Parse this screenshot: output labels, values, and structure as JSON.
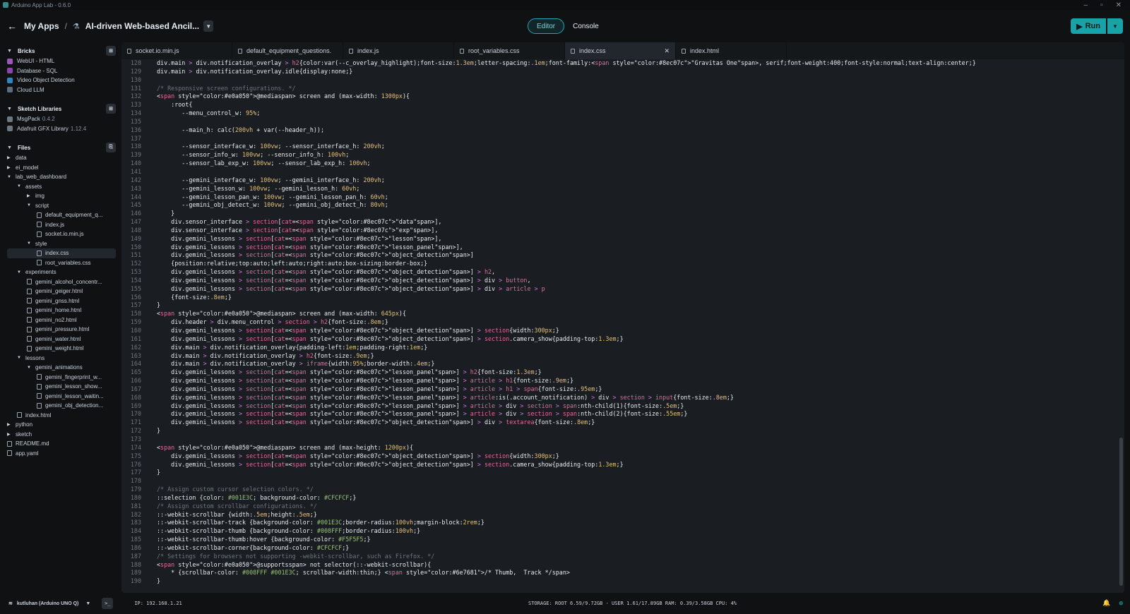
{
  "window": {
    "title": "Arduino App Lab - 0.6.0"
  },
  "header": {
    "back_label": "My Apps",
    "app_name": "AI-driven Web-based Ancil...",
    "tabs": [
      "Editor",
      "Console"
    ],
    "active_tab": "Editor",
    "run_label": "Run"
  },
  "sidebar": {
    "bricks_title": "Bricks",
    "bricks": [
      {
        "label": "WebUI - HTML",
        "color": "#9b59b6"
      },
      {
        "label": "Database - SQL",
        "color": "#8e44ad"
      },
      {
        "label": "Video Object Detection",
        "color": "#2e86c1"
      },
      {
        "label": "Cloud LLM",
        "color": "#5d6d7e"
      }
    ],
    "libraries_title": "Sketch Libraries",
    "libraries": [
      {
        "name": "MsgPack",
        "version": "0.4.2"
      },
      {
        "name": "Adafruit GFX Library",
        "version": "1.12.4"
      }
    ],
    "files_title": "Files",
    "files": [
      {
        "label": "data",
        "kind": "folder",
        "depth": 0,
        "open": false
      },
      {
        "label": "ei_model",
        "kind": "folder",
        "depth": 0,
        "open": false
      },
      {
        "label": "lab_web_dashboard",
        "kind": "folder",
        "depth": 0,
        "open": true
      },
      {
        "label": "assets",
        "kind": "folder",
        "depth": 1,
        "open": true
      },
      {
        "label": "img",
        "kind": "folder",
        "depth": 2,
        "open": false
      },
      {
        "label": "script",
        "kind": "folder",
        "depth": 2,
        "open": true
      },
      {
        "label": "default_equipment_q...",
        "kind": "file",
        "depth": 3
      },
      {
        "label": "index.js",
        "kind": "file",
        "depth": 3
      },
      {
        "label": "socket.io.min.js",
        "kind": "file",
        "depth": 3
      },
      {
        "label": "style",
        "kind": "folder",
        "depth": 2,
        "open": true
      },
      {
        "label": "index.css",
        "kind": "file",
        "depth": 3,
        "selected": true
      },
      {
        "label": "root_variables.css",
        "kind": "file",
        "depth": 3
      },
      {
        "label": "experiments",
        "kind": "folder",
        "depth": 1,
        "open": true
      },
      {
        "label": "gemini_alcohol_concentr...",
        "kind": "file",
        "depth": 2
      },
      {
        "label": "gemini_geiger.html",
        "kind": "file",
        "depth": 2
      },
      {
        "label": "gemini_gnss.html",
        "kind": "file",
        "depth": 2
      },
      {
        "label": "gemini_home.html",
        "kind": "file",
        "depth": 2
      },
      {
        "label": "gemini_no2.html",
        "kind": "file",
        "depth": 2
      },
      {
        "label": "gemini_pressure.html",
        "kind": "file",
        "depth": 2
      },
      {
        "label": "gemini_water.html",
        "kind": "file",
        "depth": 2
      },
      {
        "label": "gemini_weight.html",
        "kind": "file",
        "depth": 2
      },
      {
        "label": "lessons",
        "kind": "folder",
        "depth": 1,
        "open": true
      },
      {
        "label": "gemini_animations",
        "kind": "folder",
        "depth": 2,
        "open": true
      },
      {
        "label": "gemini_fingerprint_w...",
        "kind": "file",
        "depth": 3
      },
      {
        "label": "gemini_lesson_show...",
        "kind": "file",
        "depth": 3
      },
      {
        "label": "gemini_lesson_waitin...",
        "kind": "file",
        "depth": 3
      },
      {
        "label": "gemini_obj_detection...",
        "kind": "file",
        "depth": 3
      },
      {
        "label": "index.html",
        "kind": "file",
        "depth": 1
      },
      {
        "label": "python",
        "kind": "folder",
        "depth": 0,
        "open": false
      },
      {
        "label": "sketch",
        "kind": "folder",
        "depth": 0,
        "open": false
      },
      {
        "label": "README.md",
        "kind": "file",
        "depth": 0
      },
      {
        "label": "app.yaml",
        "kind": "file",
        "depth": 0
      }
    ]
  },
  "editor": {
    "tabs": [
      {
        "label": "socket.io.min.js",
        "active": false
      },
      {
        "label": "default_equipment_questions.",
        "active": false
      },
      {
        "label": "index.js",
        "active": false
      },
      {
        "label": "root_variables.css",
        "active": false
      },
      {
        "label": "index.css",
        "active": true
      },
      {
        "label": "index.html",
        "active": false
      }
    ],
    "lines": [
      {
        "n": "128",
        "t": "div.main > div.notification_overlay > h2{color:var(--c_overlay_highlight);font-size:1.3em;letter-spacing:.1em;font-family:\"Gravitas One\", serif;font-weight:400;font-style:normal;text-align:center;}"
      },
      {
        "n": "129",
        "t": "div.main > div.notification_overlay.idle{display:none;}"
      },
      {
        "n": "130",
        "t": ""
      },
      {
        "n": "131",
        "t": "/* Responsive screen configurations. */"
      },
      {
        "n": "132",
        "t": "@media screen and (max-width: 1300px){"
      },
      {
        "n": "133",
        "t": "    :root{"
      },
      {
        "n": "134",
        "t": "       --menu_control_w: 95%;"
      },
      {
        "n": "135",
        "t": ""
      },
      {
        "n": "136",
        "t": "       --main_h: calc(200vh + var(--header_h));"
      },
      {
        "n": "137",
        "t": ""
      },
      {
        "n": "138",
        "t": "       --sensor_interface_w: 100vw; --sensor_interface_h: 200vh;"
      },
      {
        "n": "139",
        "t": "       --sensor_info_w: 100vw; --sensor_info_h: 100vh;"
      },
      {
        "n": "140",
        "t": "       --sensor_lab_exp_w: 100vw; --sensor_lab_exp_h: 100vh;"
      },
      {
        "n": "141",
        "t": ""
      },
      {
        "n": "142",
        "t": "       --gemini_interface_w: 100vw; --gemini_interface_h: 200vh;"
      },
      {
        "n": "143",
        "t": "       --gemini_lesson_w: 100vw; --gemini_lesson_h: 60vh;"
      },
      {
        "n": "144",
        "t": "       --gemini_lesson_pan_w: 100vw; --gemini_lesson_pan_h: 60vh;"
      },
      {
        "n": "145",
        "t": "       --gemini_obj_detect_w: 100vw; --gemini_obj_detect_h: 80vh;"
      },
      {
        "n": "146",
        "t": "    }"
      },
      {
        "n": "147",
        "t": "    div.sensor_interface > section[cat=\"data\"],"
      },
      {
        "n": "148",
        "t": "    div.sensor_interface > section[cat=\"exp\"],"
      },
      {
        "n": "149",
        "t": "    div.gemini_lessons > section[cat=\"lesson\"],"
      },
      {
        "n": "150",
        "t": "    div.gemini_lessons > section[cat=\"lesson_panel\"],"
      },
      {
        "n": "151",
        "t": "    div.gemini_lessons > section[cat=\"object_detection\"]"
      },
      {
        "n": "152",
        "t": "    {position:relative;top:auto;left:auto;right:auto;box-sizing:border-box;}"
      },
      {
        "n": "153",
        "t": "    div.gemini_lessons > section[cat=\"object_detection\"] > h2,"
      },
      {
        "n": "154",
        "t": "    div.gemini_lessons > section[cat=\"object_detection\"] > div > button,"
      },
      {
        "n": "155",
        "t": "    div.gemini_lessons > section[cat=\"object_detection\"] > div > article > p"
      },
      {
        "n": "156",
        "t": "    {font-size:.8em;}"
      },
      {
        "n": "157",
        "t": "}"
      },
      {
        "n": "158",
        "t": "@media screen and (max-width: 645px){"
      },
      {
        "n": "159",
        "t": "    div.header > div.menu_control > section > h2{font-size:.8em;}"
      },
      {
        "n": "160",
        "t": "    div.gemini_lessons > section[cat=\"object_detection\"] > section{width:300px;}"
      },
      {
        "n": "161",
        "t": "    div.gemini_lessons > section[cat=\"object_detection\"] > section.camera_show{padding-top:1.3em;}"
      },
      {
        "n": "162",
        "t": "    div.main > div.notification_overlay{padding-left:1em;padding-right:1em;}"
      },
      {
        "n": "163",
        "t": "    div.main > div.notification_overlay > h2{font-size:.9em;}"
      },
      {
        "n": "164",
        "t": "    div.main > div.notification_overlay > iframe{width:95%;border-width:.4em;}"
      },
      {
        "n": "165",
        "t": "    div.gemini_lessons > section[cat=\"lesson_panel\"] > h2{font-size:1.3em;}"
      },
      {
        "n": "166",
        "t": "    div.gemini_lessons > section[cat=\"lesson_panel\"] > article > h1{font-size:.9em;}"
      },
      {
        "n": "167",
        "t": "    div.gemini_lessons > section[cat=\"lesson_panel\"] > article > h1 > span{font-size:.95em;}"
      },
      {
        "n": "168",
        "t": "    div.gemini_lessons > section[cat=\"lesson_panel\"] > article:is(.account_notification) > div > section > input{font-size:.8em;}"
      },
      {
        "n": "169",
        "t": "    div.gemini_lessons > section[cat=\"lesson_panel\"] > article > div > section > span:nth-child(1){font-size:.5em;}"
      },
      {
        "n": "170",
        "t": "    div.gemini_lessons > section[cat=\"lesson_panel\"] > article > div > section > span:nth-child(2){font-size:.55em;}"
      },
      {
        "n": "171",
        "t": "    div.gemini_lessons > section[cat=\"object_detection\"] > div > textarea{font-size:.8em;}"
      },
      {
        "n": "172",
        "t": "}"
      },
      {
        "n": "173",
        "t": ""
      },
      {
        "n": "174",
        "t": "@media screen and (max-height: 1200px){"
      },
      {
        "n": "175",
        "t": "    div.gemini_lessons > section[cat=\"object_detection\"] > section{width:300px;}"
      },
      {
        "n": "176",
        "t": "    div.gemini_lessons > section[cat=\"object_detection\"] > section.camera_show{padding-top:1.3em;}"
      },
      {
        "n": "177",
        "t": "}"
      },
      {
        "n": "178",
        "t": ""
      },
      {
        "n": "179",
        "t": "/* Assign custom cursor selection colors. */"
      },
      {
        "n": "180",
        "t": "::selection {color: #001E3C; background-color: #CFCFCF;}"
      },
      {
        "n": "181",
        "t": "/* Assign custom scrollbar configurations. */"
      },
      {
        "n": "182",
        "t": "::-webkit-scrollbar {width:.5em;height:.5em;}"
      },
      {
        "n": "183",
        "t": "::-webkit-scrollbar-track {background-color: #001E3C;border-radius:100vh;margin-block:2rem;}"
      },
      {
        "n": "184",
        "t": "::-webkit-scrollbar-thumb {background-color: #008FFF;border-radius:100vh;}"
      },
      {
        "n": "185",
        "t": "::-webkit-scrollbar-thumb:hover {background-color: #F5F5F5;}"
      },
      {
        "n": "186",
        "t": "::-webkit-scrollbar-corner{background-color: #CFCFCF;}"
      },
      {
        "n": "187",
        "t": "/* Settings for browsers not supporting -webkit-scrollbar, such as Firefox. */"
      },
      {
        "n": "188",
        "t": "@supports not selector(::-webkit-scrollbar){"
      },
      {
        "n": "189",
        "t": "    * {scrollbar-color: #008FFF #001E3C; scrollbar-width:thin;} /* Thumb,  Track */"
      },
      {
        "n": "190",
        "t": "}"
      }
    ]
  },
  "status": {
    "board": "kutluhan (Arduino UNO Q)",
    "ip": "IP: 192.168.1.21",
    "resources": "STORAGE: ROOT 6.59/9.72GB - USER 1.61/17.89GB   RAM: 0.39/3.58GB   CPU: 4%"
  },
  "colors": {
    "accent": "#17a3a7",
    "bg": "#0f1113",
    "editor_bg": "#1a1d21"
  }
}
